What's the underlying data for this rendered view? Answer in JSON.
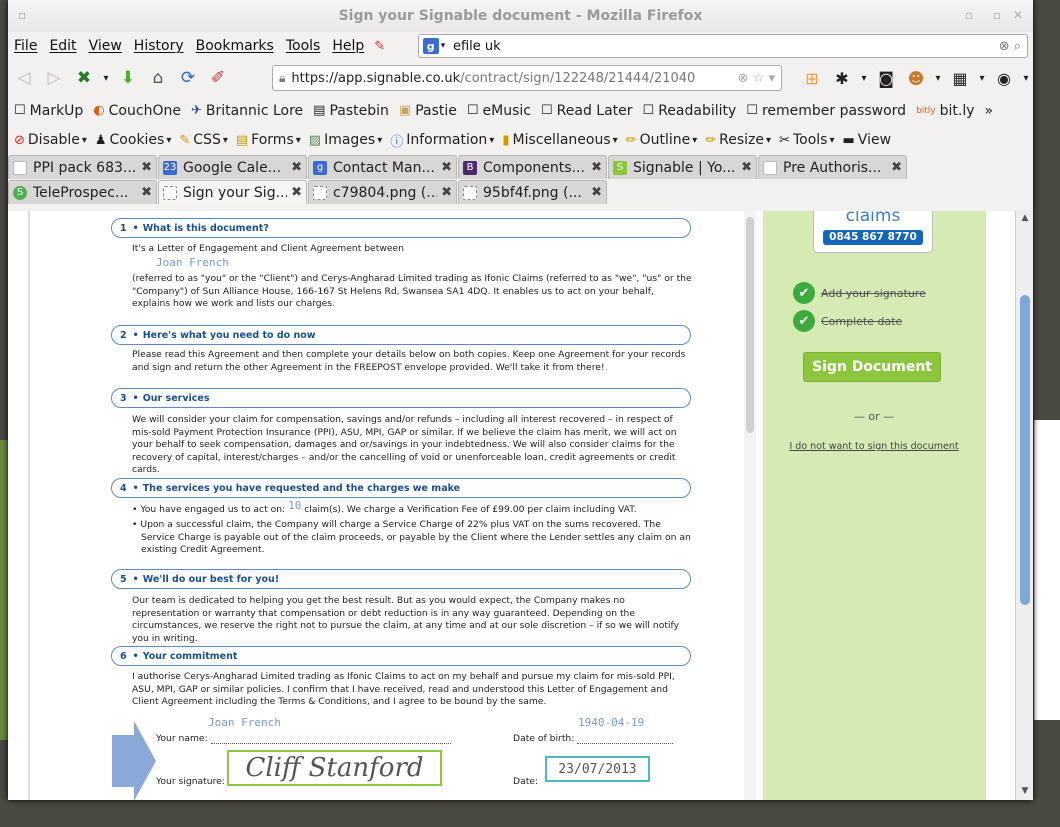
{
  "window": {
    "title": "Sign your Signable document - Mozilla Firefox"
  },
  "menu": [
    "File",
    "Edit",
    "View",
    "History",
    "Bookmarks",
    "Tools",
    "Help"
  ],
  "search": {
    "value": "efile uk"
  },
  "url": {
    "host": "https://app.signable.co.uk",
    "path": "/contract/sign/122248/21444/21040"
  },
  "bookmarks": [
    "MarkUp",
    "CouchOne",
    "Britannic Lore",
    "Pastebin",
    "Pastie",
    "eMusic",
    "Read Later",
    "Readability",
    "remember password",
    "bit.ly"
  ],
  "webdev": [
    "Disable",
    "Cookies",
    "CSS",
    "Forms",
    "Images",
    "Information",
    "Miscellaneous",
    "Outline",
    "Resize",
    "Tools",
    "View"
  ],
  "tabs_row1": [
    "PPI pack 683...",
    "Google Cale...",
    "Contact Man...",
    "Components...",
    "Signable | Yo...",
    "Pre Authoris..."
  ],
  "tabs_row2": [
    "TeleProspec...",
    "Sign your Sig...",
    "c79804.png (...",
    "95bf4f.png (..."
  ],
  "doc": {
    "s1": {
      "num": "1",
      "title": "What is this document?"
    },
    "s1_intro": "It's a Letter of Engagement and Client Agreement between",
    "client_name": "Joan French",
    "s1_body": "(referred to as \"you\" or the \"Client\") and Cerys-Angharad Limited trading as Ifonic Claims (referred to as \"we\", \"us\" or the \"Company\") of Sun Alliance House, 166-167 St Helens Rd, Swansea SA1 4DQ. It enables us to act on your behalf, explains how we work and lists our charges.",
    "s2": {
      "num": "2",
      "title": "Here's what you need to do now"
    },
    "s2_body": "Please read this Agreement and then complete your details below on both copies. Keep one Agreement for your records and sign and return the other Agreement in the FREEPOST envelope provided. We'll take it from there!",
    "s3": {
      "num": "3",
      "title": "Our services"
    },
    "s3_body": "We will consider your claim for compensation, savings and/or refunds – including all interest recovered – in respect of mis-sold Payment Protection Insurance (PPI), ASU, MPI, GAP or similar. If we believe the claim has merit, we will act on your behalf to seek compensation, damages and or/savings in your indebtedness. We will also consider claims for the recovery of capital, interest/charges – and/or the cancelling of void or unenforceable loan, credit agreements or credit cards.",
    "s4": {
      "num": "4",
      "title": "The services you have requested and the charges we make"
    },
    "s4_b1a": "You have engaged us to act on:",
    "s4_claims": "10",
    "s4_b1b": "claim(s). We charge a Verification Fee of £99.00 per claim including VAT.",
    "s4_b2": "Upon a successful claim, the Company will charge a Service Charge of 22% plus VAT on the sums recovered. The Service Charge is payable out of the claim proceeds, or payable by the Client where the Lender settles any claim on an existing Credit Agreement.",
    "s5": {
      "num": "5",
      "title": "We'll do our best for you!"
    },
    "s5_body": "Our team is dedicated to helping you get the best result. But as you would expect, the Company makes no representation or warranty that compensation or debt reduction is in any way guaranteed. Depending on the circumstances, we reserve the right not to pursue the claim, at any time and at our sole discretion – if so we will notify you in writing.",
    "s6": {
      "num": "6",
      "title": "Your commitment"
    },
    "s6_body": "I authorise Cerys-Angharad Limited trading as Ifonic Claims to act on my behalf and pursue my claim for mis-sold PPI, ASU, MPI, GAP or similar policies. I confirm that I have received, read and understood this Letter of Engagement and Client Agreement including the Terms & Conditions, and I agree to be bound by the same.",
    "name_label": "Your name:",
    "name_value": "Joan French",
    "dob_label": "Date of birth:",
    "dob_value": "1940-04-19",
    "sig_label": "Your signature:",
    "sig_value": "Cliff Stanford",
    "date_label": "Date:",
    "date_value": "23/07/2013"
  },
  "sidebar": {
    "logo_text": "claims",
    "phone": "0845 867 8770",
    "check1": "Add your signature",
    "check2": "Complete date",
    "sign_button": "Sign Document",
    "or": "— or —",
    "no_sign": "I do not want to sign this document"
  },
  "colors": {
    "accent_green": "#8cc63f",
    "sidebar_bg": "#d6eab4",
    "section_blue": "#1b4f8c"
  }
}
